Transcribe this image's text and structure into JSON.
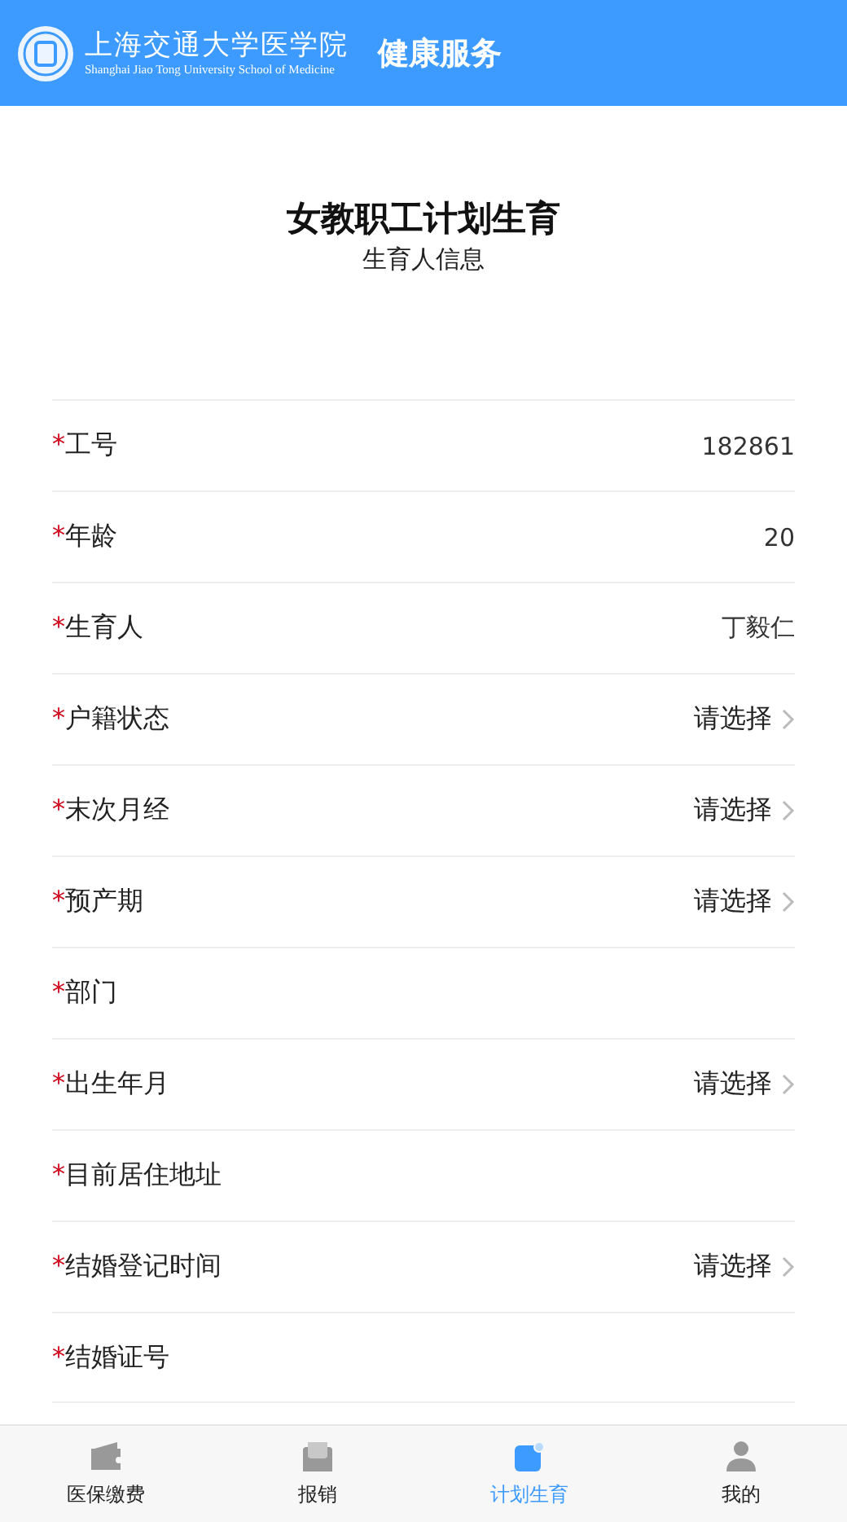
{
  "header": {
    "logo_cn": "上海交通大学医学院",
    "logo_en": "Shanghai Jiao Tong University School of Medicine",
    "title": "健康服务"
  },
  "page": {
    "title": "女教职工计划生育",
    "subtitle": "生育人信息"
  },
  "fields": [
    {
      "mark": "*",
      "label": "工号",
      "kind": "value",
      "value": "182861"
    },
    {
      "mark": "*",
      "label": "年龄",
      "kind": "value",
      "value": "20"
    },
    {
      "mark": "*",
      "label": "生育人",
      "kind": "value",
      "value": "丁毅仁"
    },
    {
      "mark": "*",
      "label": "户籍状态",
      "kind": "select",
      "placeholder": "请选择"
    },
    {
      "mark": "*",
      "label": "末次月经",
      "kind": "select",
      "placeholder": "请选择"
    },
    {
      "mark": "*",
      "label": "预产期",
      "kind": "select",
      "placeholder": "请选择"
    },
    {
      "mark": "*",
      "label": "部门",
      "kind": "input"
    },
    {
      "mark": "*",
      "label": "出生年月",
      "kind": "select",
      "placeholder": "请选择"
    },
    {
      "mark": "*",
      "label": "目前居住地址",
      "kind": "input"
    },
    {
      "mark": "*",
      "label": "结婚登记时间",
      "kind": "select",
      "placeholder": "请选择"
    },
    {
      "mark": "*",
      "label": "结婚证号",
      "kind": "input"
    }
  ],
  "tabbar": [
    {
      "label": "医保缴费",
      "selected": false
    },
    {
      "label": "报销",
      "selected": false
    },
    {
      "label": "计划生育",
      "selected": true
    },
    {
      "label": "我的",
      "selected": false
    }
  ]
}
